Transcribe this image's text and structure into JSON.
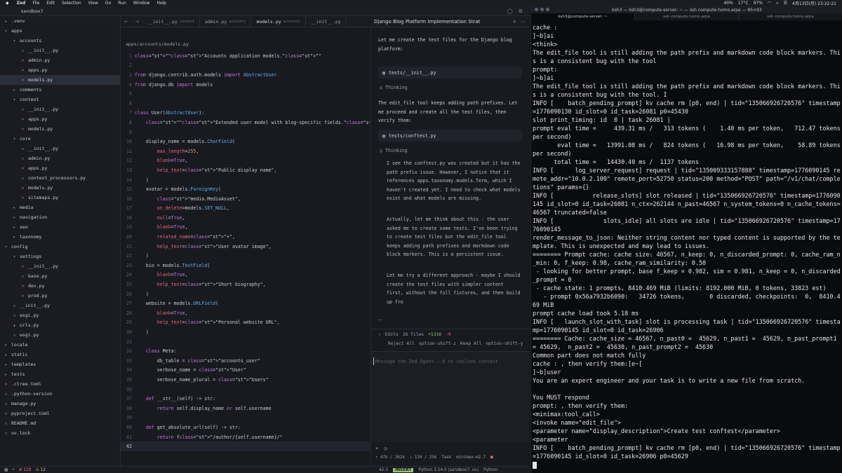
{
  "menubar": {
    "apple": "",
    "app": "Zed",
    "menus": [
      "File",
      "Edit",
      "Selection",
      "View",
      "Go",
      "Run",
      "Window",
      "Help"
    ],
    "status_items": [
      "40%",
      "17°C",
      "97%",
      "4月13日(月) 23:22:21"
    ]
  },
  "zed": {
    "project_name": "sandbox7",
    "tabs": [
      {
        "name": "__init__.py",
        "sub": "content"
      },
      {
        "name": "admin.py",
        "sub": "accounts"
      },
      {
        "name": "models.py",
        "sub": "accounts"
      },
      {
        "name": "__init__.py",
        "sub": ""
      }
    ],
    "breadcrumb": "apps/accounts/models.py",
    "tree": [
      {
        "label": ".venv",
        "indent": 0,
        "icon": "folder-closed"
      },
      {
        "label": "apps",
        "indent": 0,
        "icon": "folder-open"
      },
      {
        "label": "accounts",
        "indent": 1,
        "icon": "folder-open"
      },
      {
        "label": "__init__.py",
        "indent": 2,
        "icon": "file"
      },
      {
        "label": "admin.py",
        "indent": 2,
        "icon": "x"
      },
      {
        "label": "apps.py",
        "indent": 2,
        "icon": "x"
      },
      {
        "label": "models.py",
        "indent": 2,
        "icon": "x",
        "selected": true
      },
      {
        "label": "comments",
        "indent": 1,
        "icon": "folder-closed"
      },
      {
        "label": "content",
        "indent": 1,
        "icon": "folder-open"
      },
      {
        "label": "__init__.py",
        "indent": 2,
        "icon": "file"
      },
      {
        "label": "apps.py",
        "indent": 2,
        "icon": "x"
      },
      {
        "label": "models.py",
        "indent": 2,
        "icon": "x"
      },
      {
        "label": "core",
        "indent": 1,
        "icon": "folder-open"
      },
      {
        "label": "__init__.py",
        "indent": 2,
        "icon": "file"
      },
      {
        "label": "admin.py",
        "indent": 2,
        "icon": "file"
      },
      {
        "label": "apps.py",
        "indent": 2,
        "icon": "x"
      },
      {
        "label": "context_processors.py",
        "indent": 2,
        "icon": "file"
      },
      {
        "label": "models.py",
        "indent": 2,
        "icon": "x"
      },
      {
        "label": "sitemaps.py",
        "indent": 2,
        "icon": "x"
      },
      {
        "label": "media",
        "indent": 1,
        "icon": "folder-closed"
      },
      {
        "label": "navigation",
        "indent": 1,
        "icon": "folder-closed"
      },
      {
        "label": "seo",
        "indent": 1,
        "icon": "folder-closed"
      },
      {
        "label": "taxonomy",
        "indent": 1,
        "icon": "folder-closed"
      },
      {
        "label": "config",
        "indent": 0,
        "icon": "folder-open"
      },
      {
        "label": "settings",
        "indent": 1,
        "icon": "folder-open"
      },
      {
        "label": "__init__.py",
        "indent": 2,
        "icon": "x"
      },
      {
        "label": "base.py",
        "indent": 2,
        "icon": "file"
      },
      {
        "label": "dev.py",
        "indent": 2,
        "icon": "x"
      },
      {
        "label": "prod.py",
        "indent": 2,
        "icon": "x"
      },
      {
        "label": "__init__.py",
        "indent": 1,
        "icon": "file"
      },
      {
        "label": "asgi.py",
        "indent": 1,
        "icon": "file"
      },
      {
        "label": "urls.py",
        "indent": 1,
        "icon": "warn"
      },
      {
        "label": "wsgi.py",
        "indent": 1,
        "icon": "file"
      },
      {
        "label": "locale",
        "indent": 0,
        "icon": "folder-closed"
      },
      {
        "label": "static",
        "indent": 0,
        "icon": "folder-closed"
      },
      {
        "label": "templates",
        "indent": 0,
        "icon": "folder-closed"
      },
      {
        "label": "tests",
        "indent": 0,
        "icon": "folder-closed"
      },
      {
        "label": ".ctree.toml",
        "indent": 0,
        "icon": "x"
      },
      {
        "label": ".python-version",
        "indent": 0,
        "icon": "file"
      },
      {
        "label": "manage.py",
        "indent": 0,
        "icon": "file"
      },
      {
        "label": "pyproject.toml",
        "indent": 0,
        "icon": "file"
      },
      {
        "label": "README.md",
        "indent": 0,
        "icon": "file"
      },
      {
        "label": "uv.lock",
        "indent": 0,
        "icon": "file"
      }
    ],
    "code": [
      {
        "n": "1",
        "t": "\"\"\"Accounts application models.\"\"\""
      },
      {
        "n": "2",
        "t": ""
      },
      {
        "n": "3",
        "t": "from django.contrib.auth.models import AbstractUser"
      },
      {
        "n": "4",
        "t": "from django.db import models"
      },
      {
        "n": "5",
        "t": ""
      },
      {
        "n": "6",
        "t": ""
      },
      {
        "n": "7",
        "t": "class User(AbstractUser):"
      },
      {
        "n": "8",
        "t": "    \"\"\"Extended user model with blog-specific fields.\"\"\""
      },
      {
        "n": "9",
        "t": ""
      },
      {
        "n": "10",
        "t": "    display_name = models.CharField("
      },
      {
        "n": "11",
        "t": "        max_length=255,"
      },
      {
        "n": "12",
        "t": "        blank=True,"
      },
      {
        "n": "13",
        "t": "        help_text=\"Public display name\","
      },
      {
        "n": "14",
        "t": "    )"
      },
      {
        "n": "15",
        "t": "    avatar = models.ForeignKey("
      },
      {
        "n": "16",
        "t": "        \"media.MediaAsset\","
      },
      {
        "n": "17",
        "t": "        on_delete=models.SET_NULL,"
      },
      {
        "n": "18",
        "t": "        null=True,"
      },
      {
        "n": "19",
        "t": "        blank=True,"
      },
      {
        "n": "20",
        "t": "        related_name=\"+\","
      },
      {
        "n": "21",
        "t": "        help_text=\"User avatar image\","
      },
      {
        "n": "22",
        "t": "    )"
      },
      {
        "n": "23",
        "t": "    bio = models.TextField("
      },
      {
        "n": "24",
        "t": "        blank=True,"
      },
      {
        "n": "25",
        "t": "        help_text=\"Short biography\","
      },
      {
        "n": "26",
        "t": "    )"
      },
      {
        "n": "27",
        "t": "    website = models.URLField("
      },
      {
        "n": "28",
        "t": "        blank=True,"
      },
      {
        "n": "29",
        "t": "        help_text=\"Personal website URL\","
      },
      {
        "n": "30",
        "t": "    )"
      },
      {
        "n": "31",
        "t": ""
      },
      {
        "n": "32",
        "t": "    class Meta:"
      },
      {
        "n": "33",
        "t": "        db_table = \"accounts_user\""
      },
      {
        "n": "34",
        "t": "        verbose_name = \"User\""
      },
      {
        "n": "35",
        "t": "        verbose_name_plural = \"Users\""
      },
      {
        "n": "36",
        "t": ""
      },
      {
        "n": "37",
        "t": "    def __str__(self) -> str:"
      },
      {
        "n": "38",
        "t": "        return self.display_name or self.username"
      },
      {
        "n": "39",
        "t": ""
      },
      {
        "n": "40",
        "t": "    def get_absolute_url(self) -> str:"
      },
      {
        "n": "41",
        "t": "        return f\"/author/{self.username}/\""
      },
      {
        "n": "42",
        "t": ""
      }
    ],
    "agent": {
      "title": "Django Blog Platform Implementation Strat",
      "msg1": "Let me create the test files for the Django blog platform:",
      "tool1": "tests/__init__.py",
      "thinking_label": "Thinking",
      "msg2": "The edit_file tool keeps adding path prefixes. Let me proceed and create all the test files, then verify them:",
      "tool2": "tests/conftest.py",
      "think_p1": "I see the conftest.py was created but it has the path prefix issue. However, I notice that it references apps.taxonomy.models.Term, which I haven't created yet. I need to check what models exist and what models are missing.",
      "think_p2": "Actually, let me think about this - the user asked me to create some tests. I've been trying to create test files but the edit_file tool keeps adding path prefixes and markdown code block markers. This is a persistent issue.",
      "think_p3": "Let me try a different approach - maybe I should create the test files with simpler content first, without the full fixtures, and then build up fro",
      "ellipsis": "…",
      "edits_label": "Edits",
      "edits_files": "26 files",
      "edits_add": "+1316",
      "edits_del": "-0",
      "reject_all": "Reject All",
      "reject_shortcut": "option-shift-z",
      "keep_all": "Keep All",
      "keep_shortcut": "option-shift-y",
      "input_placeholder": "Message the Zed Agent — @ to include context",
      "stat_tokens": "↑ 47k / 262k",
      "stat_cost": "↓ 134 / 256",
      "stat_mode": "Task",
      "stat_model": "minimax-m2.7"
    },
    "status": {
      "errors": "118",
      "warnings": "12",
      "cursor": "42:1",
      "mode": "INSERT",
      "python": "Python 3.14.0 (sandbox7: uv)",
      "lang": "Python"
    }
  },
  "terminal": {
    "title": "ksh3 — ksh3@compute-server: ~ — ssh compute.homo.arpa — 85×93",
    "tabs": [
      "ksh3@compute-server: ~",
      "ssh compute.homo.arpa",
      "ssh compute.homo.arpa"
    ],
    "lines": [
      "cache :",
      "]~b]ai",
      "<think>",
      "The edit_file tool is still adding the path prefix and markdown code block markers. This is a consistent bug with the tool",
      "prompt:",
      "]~b]ai",
      "The edit_file tool is still adding the path prefix and markdown code block markers. This is a consistent bug with the tool. I",
      "INFO [    batch_pending_prompt] kv cache rm [p0, end) | tid=\"135066926720576\" timestamp=1776090130 id_slot=0 id_task=26081 p0=45430",
      "slot print_timing: id  0 | task 26081 |",
      "prompt eval time =     439.31 ms /   313 tokens (    1.40 ms per token,   712.47 tokens per second)",
      "       eval time =   13991.08 ms /   824 tokens (   16.98 ms per token,    58.89 tokens per second)",
      "      total time =   14430.40 ms /  1137 tokens",
      "INFO [      log_server_request] request | tid=\"135009333157888\" timestamp=1776090145 remote_addr=\"10.0.2.100\" remote_port=52750 status=200 method=\"POST\" path=\"/v1/chat/completions\" params={}",
      "INFO [           release_slots] slot released | tid=\"135066926720576\" timestamp=1776090145 id_slot=0 id_task=26081 n_ctx=262144 n_past=46567 n_system_tokens=0 n_cache_tokens=46567 truncated=false",
      "INFO [              slots_idle] all slots are idle | tid=\"135066926720576\" timestamp=1776090145",
      "render_message_to_json: Neither string content nor typed content is supported by the template. This is unexpected and may lead to issues.",
      "======== Prompt cache: cache size: 46567, n_keep: 0, n_discarded_prompt: 0, cache_ram_n_min: 0, f_keep: 0.98, cache_ram_similarity: 0.50",
      " - looking for better prompt, base f_keep = 0.982, sim = 0.981, n_keep = 0, n_discarded_prompt = 0",
      " - cache state: 1 prompts, 8410.469 MiB (limits: 8192.000 MiB, 0 tokens, 33823 est)",
      "   - prompt 0x56a7932b6090:   34726 tokens,       0 discarded, checkpoints:  0,  8410.469 MiB",
      "prompt cache load took 5.18 ms",
      "INFO [   launch_slot_with_task] slot is processing task | tid=\"135066926720576\" timestamp=1776090145 id_slot=0 id_task=26906",
      "======== Cache: cache_size = 46567, n_past0 =  45629, n_past1 =  45629, n_past_prompt1 = 45629,  n_past2 =  45630, n_past_prompt2 =  45630",
      "Common part does not match fully",
      "cache : , then verify them:[e~[",
      "]~b]user",
      "You are an expert engineer and your task is to write a new file from scratch.",
      "",
      "You MUST respond",
      "prompt: , then verify them:",
      "<minimax:tool_call>",
      "<invoke name=\"edit_file\">",
      "<parameter name=\"display_description\">Create test conftest</parameter>",
      "<parameter",
      "INFO [    batch_pending_prompt] kv cache rm [p0, end) | tid=\"135066926720576\" timestamp=1776090145 id_slot=0 id_task=26906 p0=45629"
    ]
  }
}
